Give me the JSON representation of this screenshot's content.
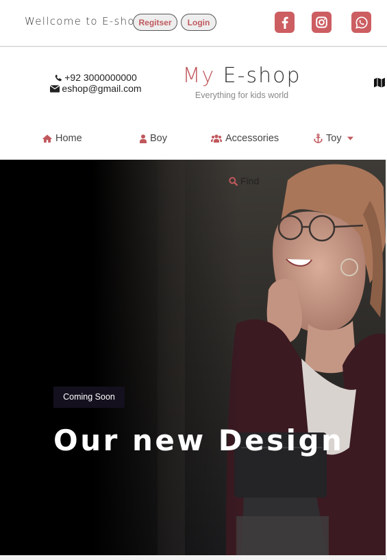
{
  "topbar": {
    "welcome": "Wellcome to E-shop",
    "register_label": "Regitser",
    "login_label": "Login",
    "social": [
      "facebook-icon",
      "instagram-icon",
      "whatsapp-icon"
    ]
  },
  "header": {
    "phone": "+92 3000000000",
    "email": "eshop@gmail.com",
    "brand_my": "My",
    "brand_name": "E-shop",
    "tagline": "Everything for kids world"
  },
  "nav": {
    "home": "Home",
    "boy": "Boy",
    "accessories": "Accessories",
    "toy": "Toy"
  },
  "hero": {
    "find_label": "Find",
    "badge": "Coming Soon",
    "headline": "Our new Design"
  },
  "colors": {
    "accent": "#c0585d",
    "social_bg": "#cc5e62",
    "badge_bg": "#14101e"
  }
}
